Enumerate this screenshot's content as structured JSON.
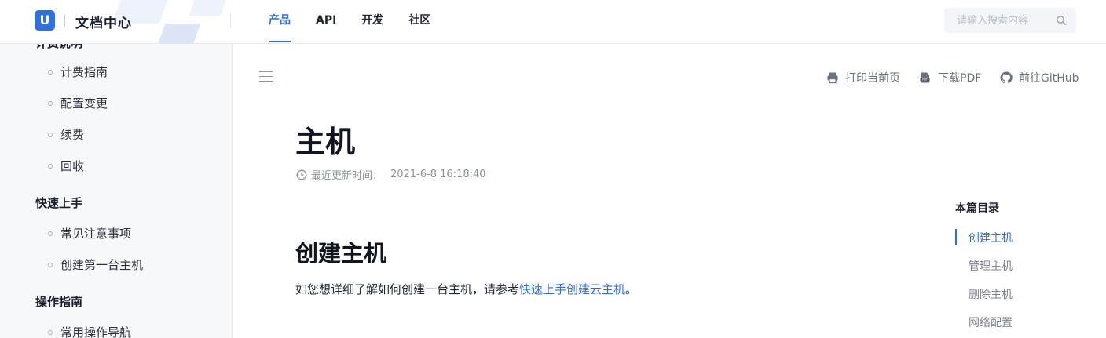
{
  "header": {
    "site_title": "文档中心",
    "logo_letter": "U",
    "nav": [
      {
        "label": "产品",
        "active": true
      },
      {
        "label": "API",
        "active": false
      },
      {
        "label": "开发",
        "active": false
      },
      {
        "label": "社区",
        "active": false
      }
    ],
    "search_placeholder": "请输入搜索内容"
  },
  "sidebar": {
    "cut_off_section": "计费说明",
    "billing_items": [
      "计费指南",
      "配置变更",
      "续费",
      "回收"
    ],
    "quickstart": {
      "title": "快速上手",
      "items": [
        "常见注意事项",
        "创建第一台主机"
      ]
    },
    "operations": {
      "title": "操作指南",
      "items": [
        "常用操作导航"
      ]
    }
  },
  "toolbar": {
    "print": "打印当前页",
    "download": "下载PDF",
    "github": "前往GitHub"
  },
  "article": {
    "title": "主机",
    "updated_label": "最近更新时间：",
    "updated_time": "2021-6-8 16:18:40",
    "section_title": "创建主机",
    "para_prefix": "如您想详细了解如何创建一台主机，请参考",
    "para_link": "快速上手创建云主机",
    "para_suffix": "。"
  },
  "toc": {
    "title": "本篇目录",
    "items": [
      "创建主机",
      "管理主机",
      "删除主机",
      "网络配置"
    ],
    "active_index": 0
  },
  "colors": {
    "accent": "#2f6fdf",
    "sidebar_bg": "#f7f8fa"
  }
}
